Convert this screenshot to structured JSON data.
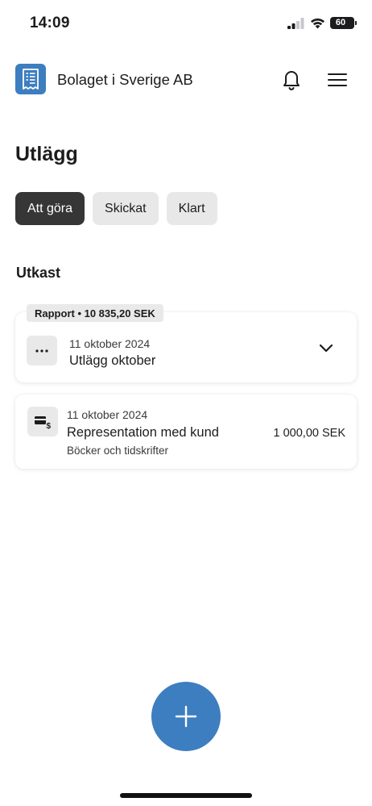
{
  "status_bar": {
    "time": "14:09",
    "battery": "60"
  },
  "header": {
    "company_name": "Bolaget i Sverige AB",
    "logo_icon": "receipt-icon",
    "notification_icon": "bell-icon",
    "menu_icon": "hamburger-menu-icon"
  },
  "page": {
    "title": "Utlägg"
  },
  "tabs": [
    {
      "label": "Att göra",
      "active": true
    },
    {
      "label": "Skickat",
      "active": false
    },
    {
      "label": "Klart",
      "active": false
    }
  ],
  "section": {
    "title": "Utkast"
  },
  "report": {
    "badge": "Rapport • 10 835,20 SEK",
    "date": "11 oktober 2024",
    "title": "Utlägg oktober",
    "icon": "more-dots-icon",
    "toggle_icon": "chevron-down-icon"
  },
  "expense": {
    "date": "11 oktober 2024",
    "title": "Representation med kund",
    "category": "Böcker och tidskrifter",
    "amount": "1 000,00 SEK",
    "icon": "card-payment-icon"
  },
  "fab": {
    "icon": "plus-icon"
  },
  "colors": {
    "brand": "#3d7ec0",
    "active_tab": "#363636",
    "chip": "#e8e8e8"
  }
}
